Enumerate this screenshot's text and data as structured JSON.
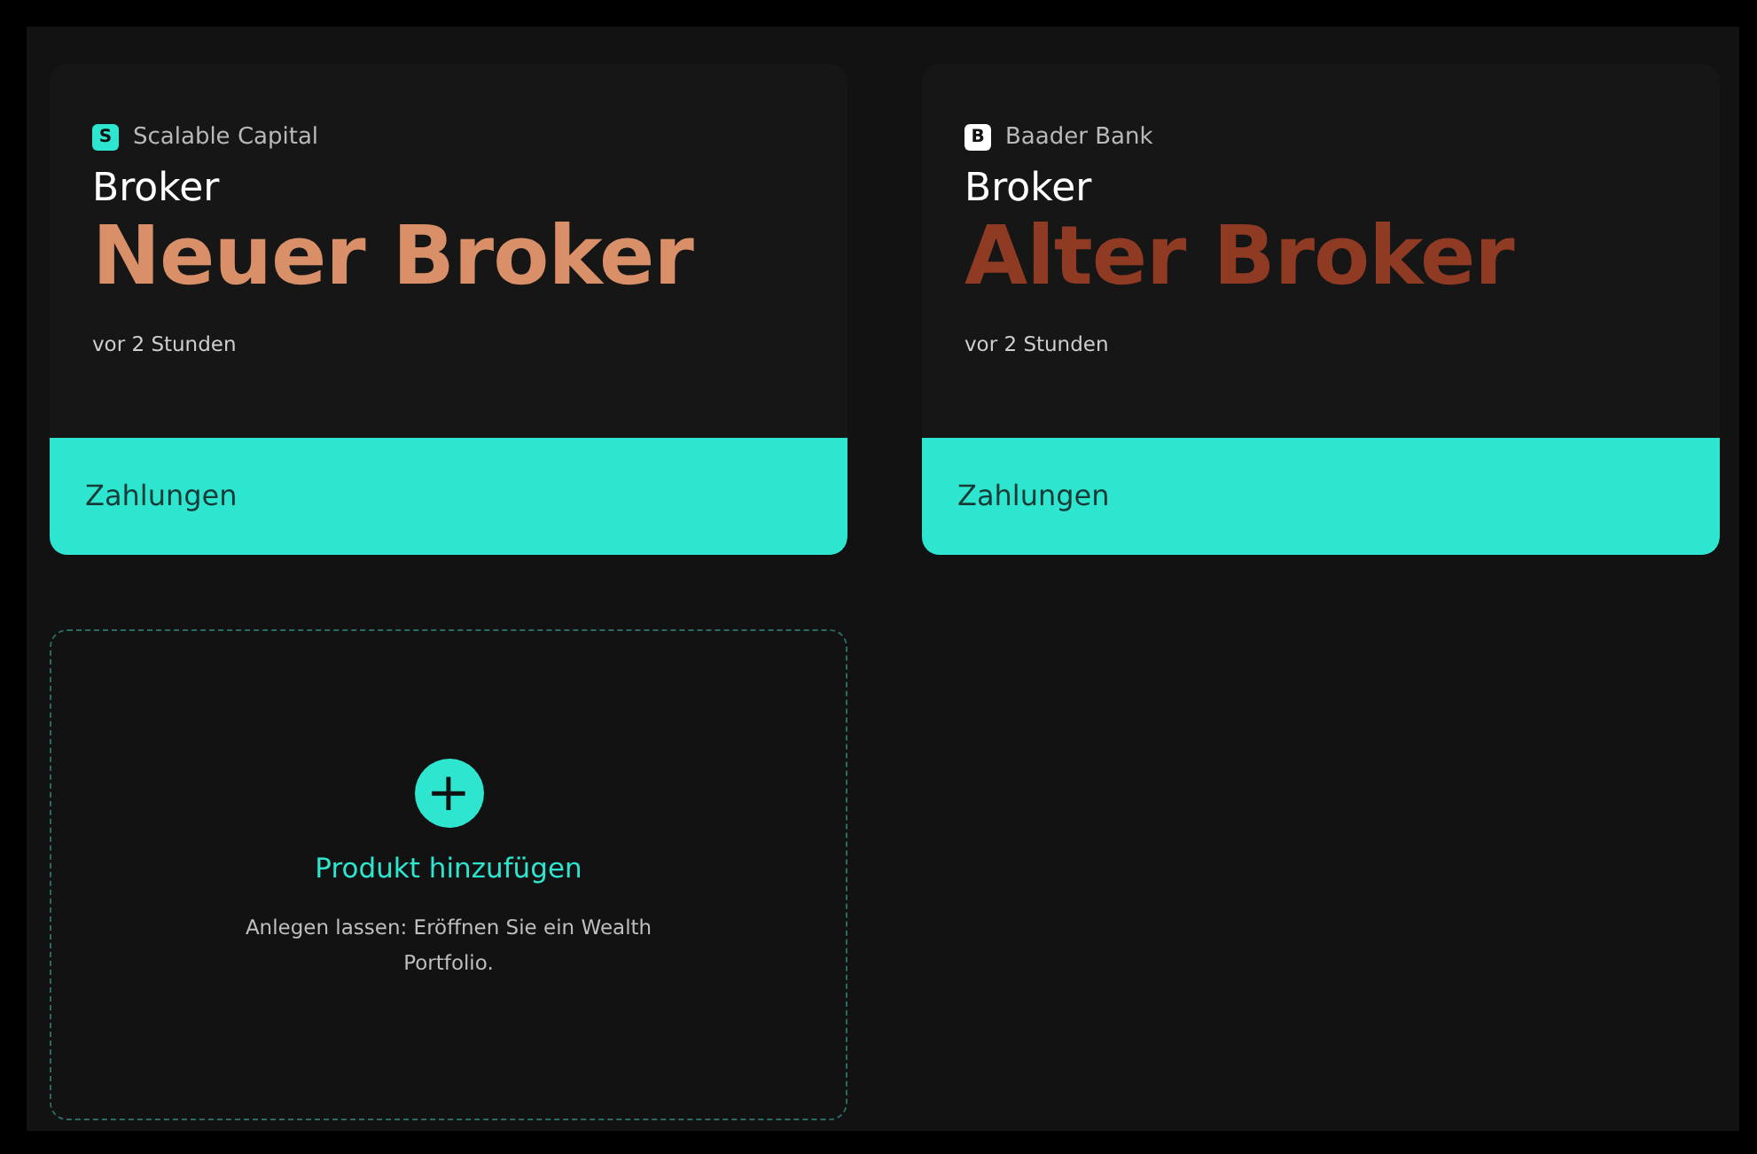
{
  "products": [
    {
      "logo": {
        "letter": "S",
        "color": "#2ee6cf"
      },
      "provider": "Scalable Capital",
      "category": "Broker",
      "headline": "Neuer Broker",
      "color": "#d98f68",
      "time": "vor 2 Stunden",
      "footer": "Zahlungen"
    },
    {
      "logo": {
        "letter": "B",
        "color": "#ffffff"
      },
      "provider": "Baader Bank",
      "category": "Broker",
      "headline": "Alter Broker",
      "color": "#8f3a22",
      "time": "vor 2 Stunden",
      "footer": "Zahlungen"
    }
  ],
  "add_product": {
    "icon": "+",
    "title": "Produkt hinzufügen",
    "description": "Anlegen lassen: Eröffnen Sie ein Wealth Portfolio."
  }
}
